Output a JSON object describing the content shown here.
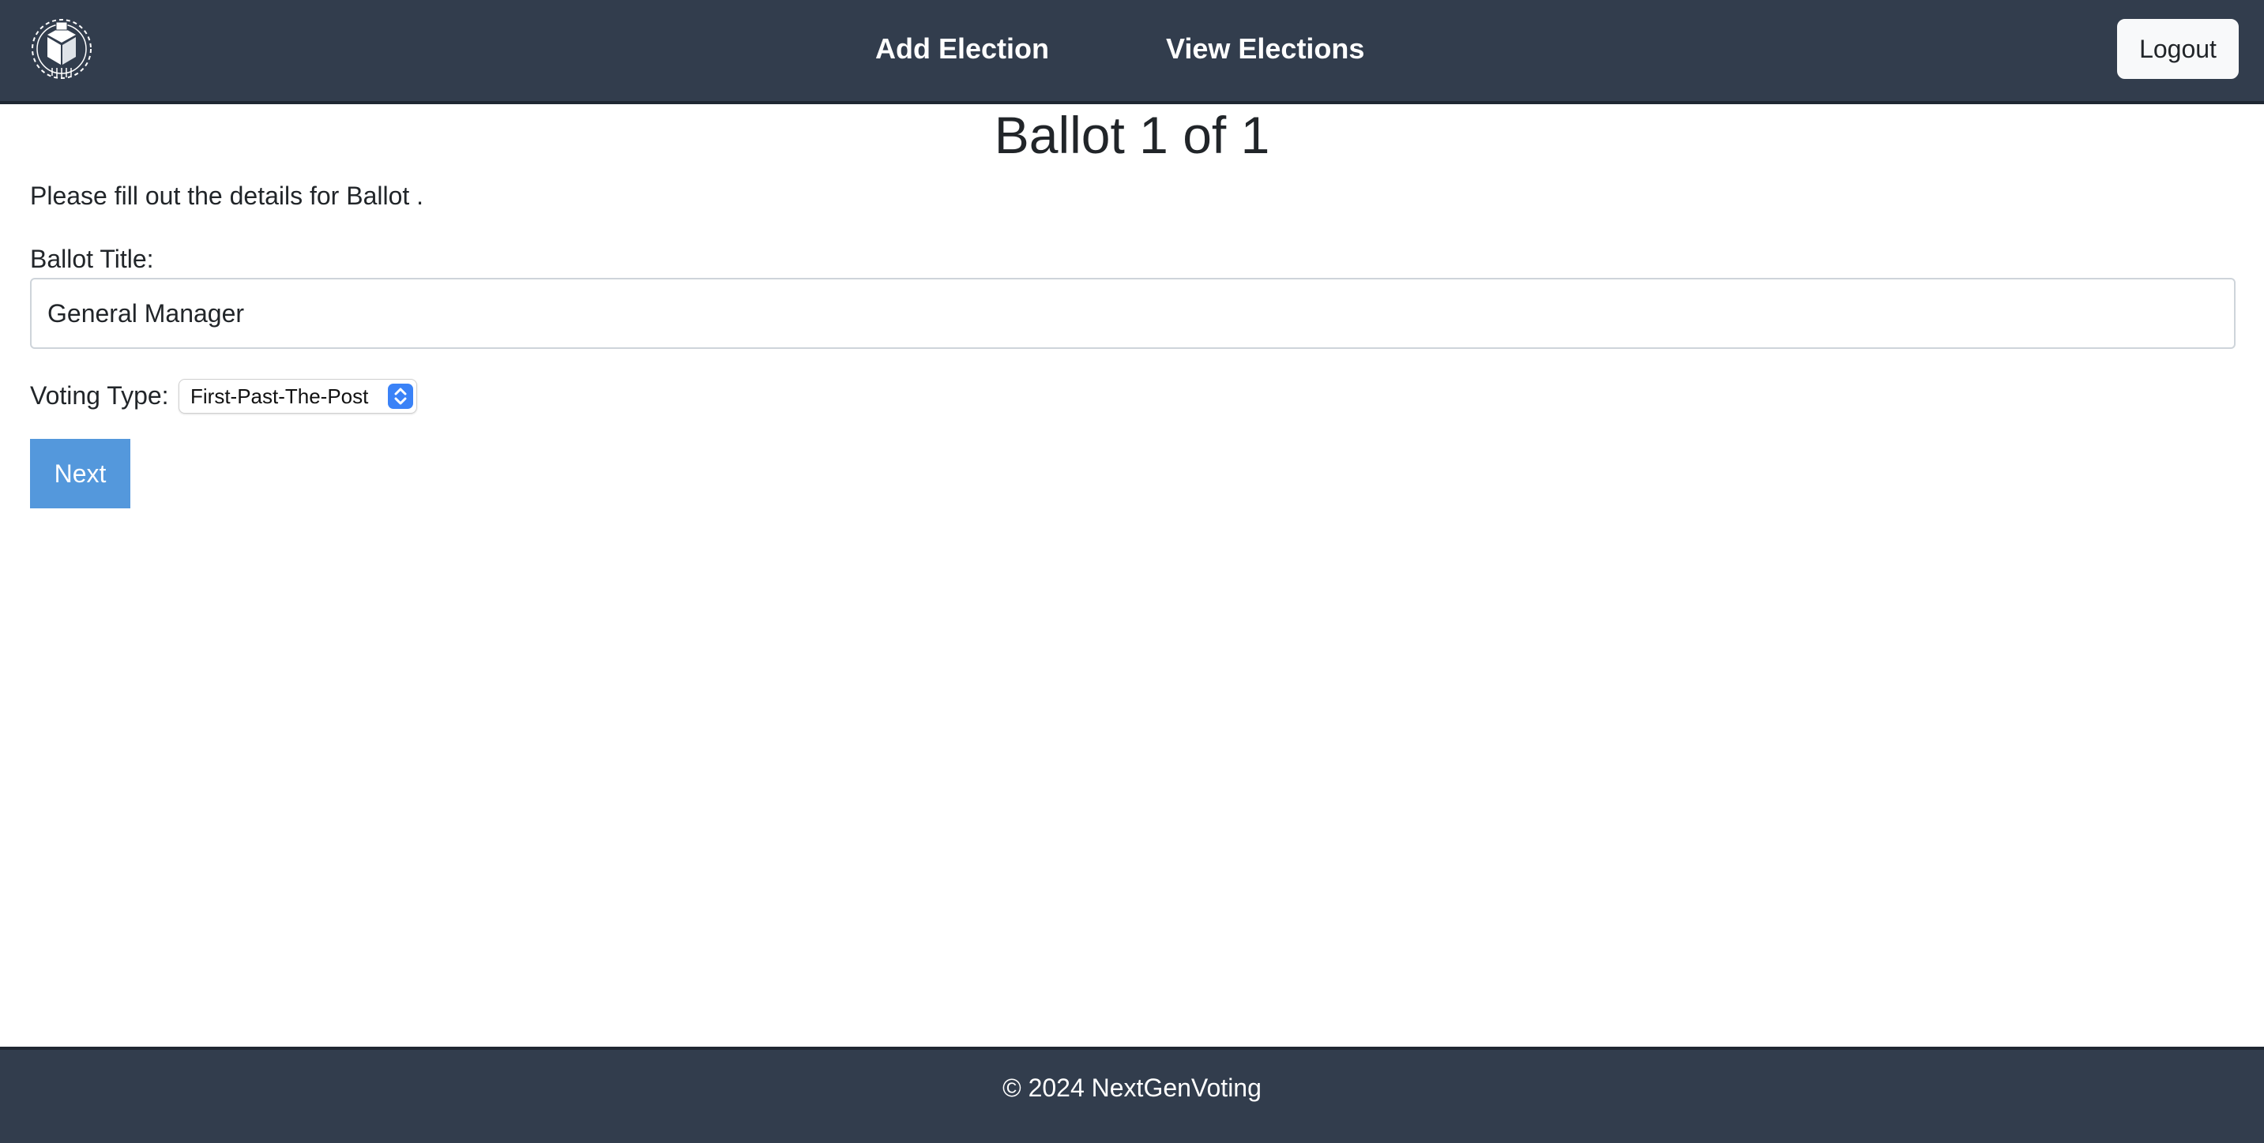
{
  "header": {
    "logo_icon": "ballot-box-logo-icon",
    "nav": [
      {
        "label": "Add Election"
      },
      {
        "label": "View Elections"
      }
    ],
    "logout_label": "Logout"
  },
  "main": {
    "heading": "Ballot 1 of 1",
    "intro": "Please fill out the details for Ballot .",
    "ballot_title_label": "Ballot Title:",
    "ballot_title_value": "General Manager",
    "voting_type_label": "Voting Type:",
    "voting_type_selected": "First-Past-The-Post",
    "next_label": "Next"
  },
  "footer": {
    "text": "© 2024 NextGenVoting"
  },
  "colors": {
    "header_bg": "#323d4d",
    "button_primary": "#5498dc",
    "select_accent": "#3a82f7"
  }
}
